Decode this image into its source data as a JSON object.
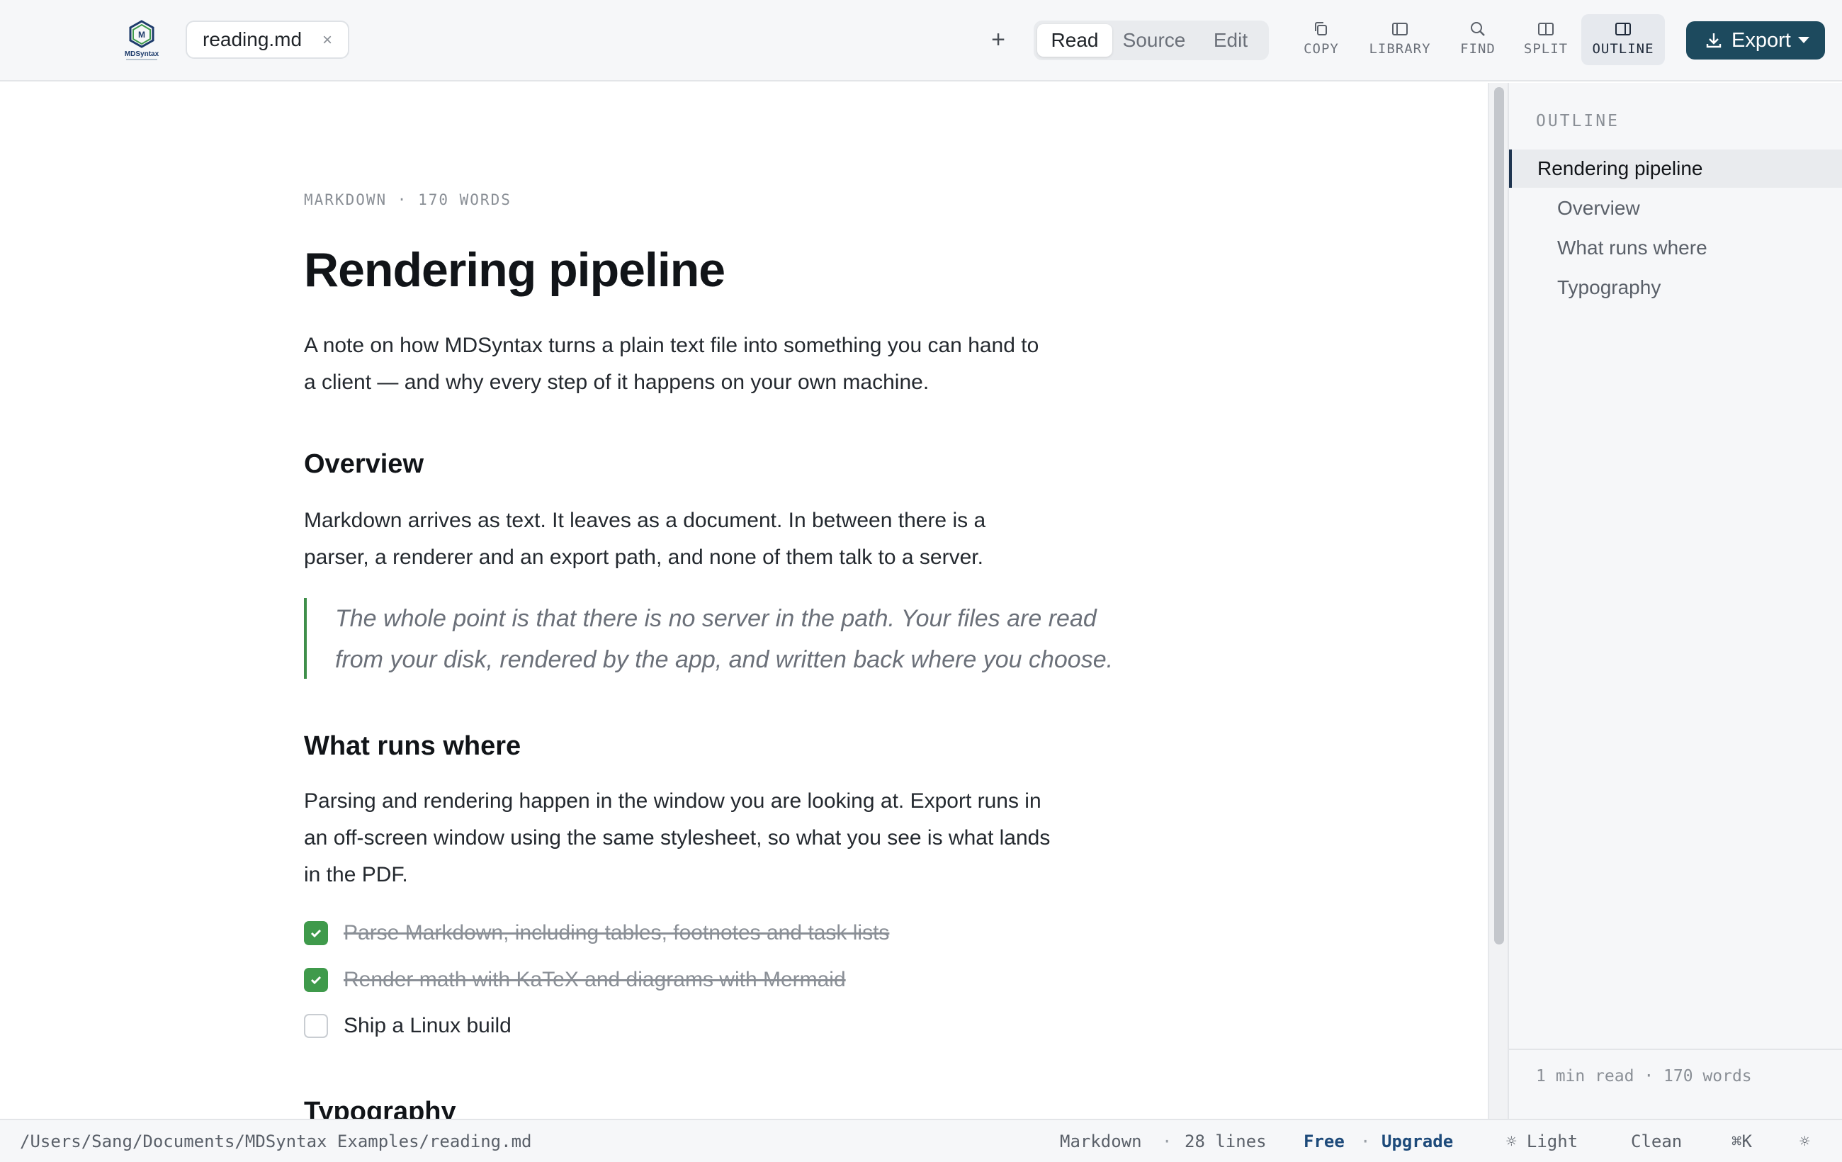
{
  "app": {
    "logo_text": "MDSyntax"
  },
  "tab": {
    "file_name": "reading.md",
    "close_glyph": "×",
    "new_tab_glyph": "+"
  },
  "view_modes": [
    {
      "label": "Read",
      "active": true
    },
    {
      "label": "Source",
      "active": false
    },
    {
      "label": "Edit",
      "active": false
    }
  ],
  "toolbar": {
    "copy": "COPY",
    "library": "LIBRARY",
    "find": "FIND",
    "split": "SPLIT",
    "outline": "OUTLINE",
    "export": "Export"
  },
  "document": {
    "meta": "MARKDOWN · 170 WORDS",
    "title": "Rendering pipeline",
    "intro_line1": "A note on how MDSyntax turns a plain text file into something you can hand to",
    "intro_line2": "a client — and why every step of it happens on your own machine.",
    "overview_heading": "Overview",
    "overview_line1": "Markdown arrives as text. It leaves as a document. In between there is a",
    "overview_line2": "parser, a renderer and an export path, and none of them talk to a server.",
    "quote_line1": "The whole point is that there is no server in the path. Your files are read",
    "quote_line2": "from your disk, rendered by the app, and written back where you choose.",
    "runs_heading": "What runs where",
    "runs_line1": "Parsing and rendering happen in the window you are looking at. Export runs in",
    "runs_line2": "an off-screen window using the same stylesheet, so what you see is what lands",
    "runs_line3": "in the PDF.",
    "tasks": [
      {
        "text": "Parse Markdown, including tables, footnotes and task lists",
        "done": true
      },
      {
        "text": "Render math with KaTeX and diagrams with Mermaid",
        "done": true
      },
      {
        "text": "Ship a Linux build",
        "done": false
      }
    ],
    "typography_heading": "Typography"
  },
  "outline": {
    "heading": "OUTLINE",
    "items": [
      {
        "label": "Rendering pipeline",
        "level": 1,
        "active": true
      },
      {
        "label": "Overview",
        "level": 2,
        "active": false
      },
      {
        "label": "What runs where",
        "level": 2,
        "active": false
      },
      {
        "label": "Typography",
        "level": 2,
        "active": false
      }
    ],
    "footer": "1 min read · 170 words"
  },
  "status": {
    "path": "/Users/Sang/Documents/MDSyntax Examples/reading.md",
    "format": "Markdown",
    "lines": "28 lines",
    "sep": "·",
    "plan": "Free",
    "upgrade": "Upgrade",
    "theme": "☼ Light",
    "style": "Clean",
    "shortcut": "⌘K",
    "settings_glyph": "☼"
  },
  "colors": {
    "accent": "#1d4a5e",
    "task_done": "#3f9a4b",
    "quote_border": "#3f8f4a"
  }
}
